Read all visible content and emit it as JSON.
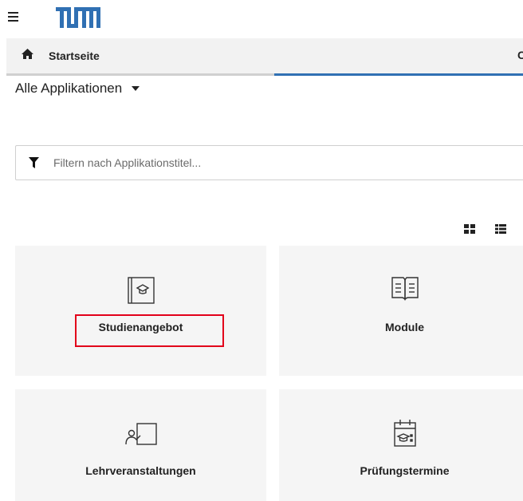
{
  "header": {
    "menu_icon": "hamburger-icon",
    "logo_text": "TUM"
  },
  "breadcrumb": {
    "home_icon": "home-icon",
    "label": "Startseite",
    "right_fragment": "C"
  },
  "section": {
    "title": "Alle Applikationen"
  },
  "filter": {
    "icon": "filter-icon",
    "placeholder": "Filtern nach Applikationstitel..."
  },
  "view_toggle": {
    "grid_icon": "grid-view-icon",
    "list_icon": "list-view-icon"
  },
  "tiles": [
    {
      "label": "Studienangebot",
      "icon": "study-offer-icon"
    },
    {
      "label": "Module",
      "icon": "open-book-icon"
    },
    {
      "label": "Lehrveranstaltungen",
      "icon": "lecture-icon"
    },
    {
      "label": "Prüfungstermine",
      "icon": "exam-calendar-icon"
    }
  ],
  "colors": {
    "accent_blue": "#3070b3",
    "highlight_red": "#e2001a",
    "tile_bg": "#f5f5f5"
  }
}
